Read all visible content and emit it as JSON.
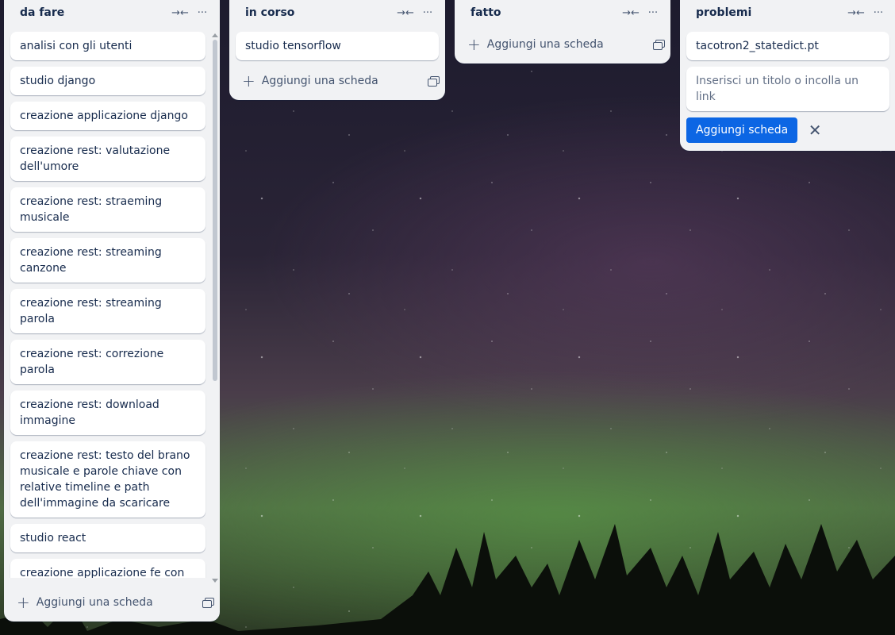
{
  "lists": [
    {
      "title": "da fare",
      "cards": [
        "analisi con gli utenti",
        "studio django",
        "creazione applicazione django",
        "creazione rest: valutazione dell'umore",
        "creazione rest: straeming musicale",
        "creazione rest: streaming canzone",
        "creazione rest: streaming parola",
        "creazione rest: correzione parola",
        "creazione rest: download immagine",
        "creazione rest: testo del brano musicale e parole chiave con relative timeline e path dell'immagine da scaricare",
        "studio react",
        "creazione applicazione fe con librerie scelte e configurazione delle stesse"
      ],
      "add_label": "Aggiungi una scheda"
    },
    {
      "title": "in corso",
      "cards": [
        "studio tensorflow"
      ],
      "add_label": "Aggiungi una scheda"
    },
    {
      "title": "fatto",
      "cards": [],
      "add_label": "Aggiungi una scheda"
    },
    {
      "title": "problemi",
      "cards": [
        "tacotron2_statedict.pt"
      ],
      "composer": {
        "placeholder": "Inserisci un titolo o incolla un link",
        "submit_label": "Aggiungi scheda",
        "close_icon": "close-icon"
      }
    }
  ],
  "icons": {
    "collapse": "collapse-icon",
    "more": "more-icon",
    "plus": "plus-icon",
    "template": "template-icon"
  },
  "colors": {
    "list_bg": "#f1f2f4",
    "card_bg": "#ffffff",
    "primary": "#0c66e4",
    "text": "#172b4d"
  }
}
